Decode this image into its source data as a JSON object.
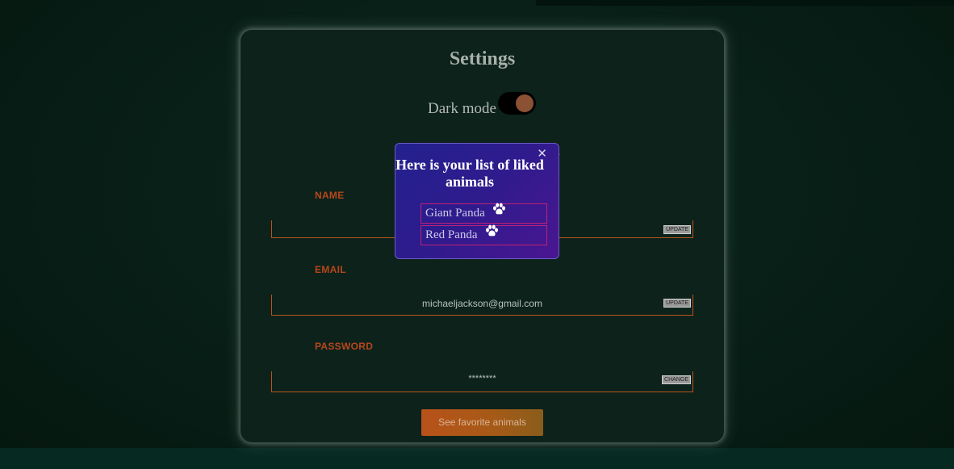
{
  "settings": {
    "title": "Settings",
    "dark_mode_label": "Dark mode",
    "dark_mode_on": true,
    "section_heading_partial": "n"
  },
  "fields": [
    {
      "label": "NAME",
      "value": "",
      "button": "UPDATE"
    },
    {
      "label": "EMAIL",
      "value": "michaeljackson@gmail.com",
      "button": "UPDATE"
    },
    {
      "label": "PASSWORD",
      "value": "********",
      "button": "CHANGE"
    }
  ],
  "favorite_button": "See favorite animals",
  "popup": {
    "close_symbol": "✕",
    "title": "Here is your list of liked animals",
    "animals": [
      {
        "name": "Giant Panda",
        "icon": "paw-icon"
      },
      {
        "name": "Red Panda",
        "icon": "paw-icon"
      }
    ]
  },
  "colors": {
    "accent": "#b8471b",
    "popup_gradient_start": "#23218e",
    "popup_gradient_end": "#4a1690",
    "list_border": "#c0207a"
  }
}
